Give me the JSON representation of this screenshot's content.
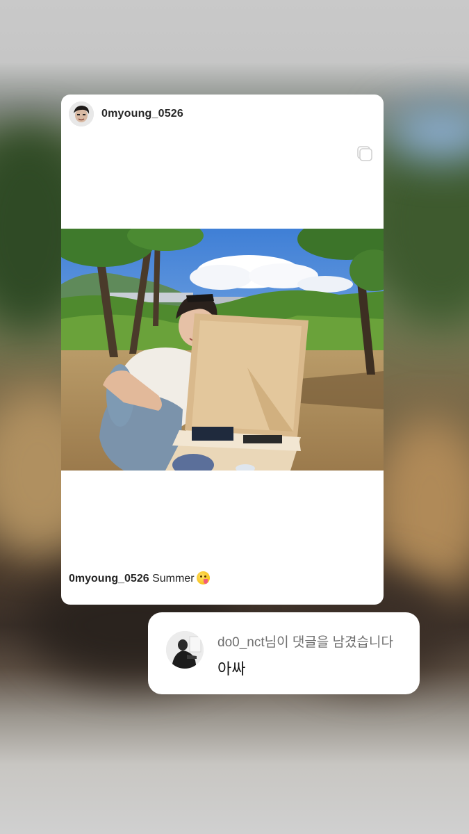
{
  "post": {
    "username": "0myoung_0526",
    "caption_user": "0myoung_0526",
    "caption_text": "Summer",
    "caption_emoji": "face-savoring-food-emoji",
    "has_multiple_images": true
  },
  "comment": {
    "title": "do0_nct님이 댓글을 남겼습니다",
    "text": "아싸"
  },
  "colors": {
    "card_bg": "#ffffff",
    "text_primary": "#262626",
    "text_secondary": "#6e6e6e"
  }
}
